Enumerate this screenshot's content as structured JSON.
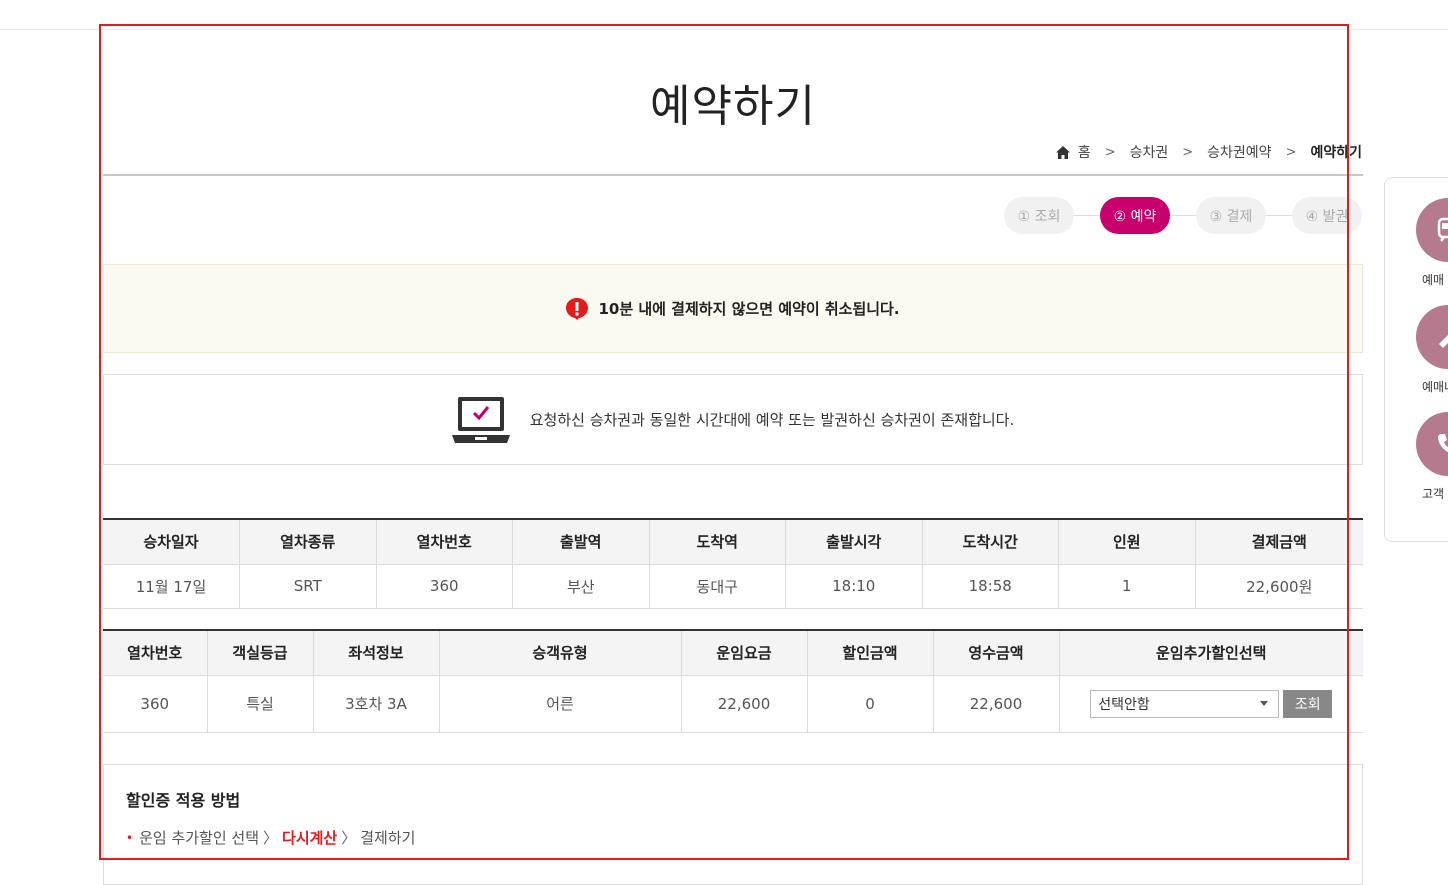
{
  "page": {
    "title": "예약하기"
  },
  "breadcrumb": {
    "home": "홈",
    "item1": "승차권",
    "item2": "승차권예약",
    "current": "예약하기"
  },
  "steps": [
    {
      "label": "① 조회"
    },
    {
      "label": "② 예약"
    },
    {
      "label": "③ 결제"
    },
    {
      "label": "④ 발권"
    }
  ],
  "notice": {
    "text": "10분 내에 결제하지 않으면 예약이 취소됩니다."
  },
  "duplicate": {
    "text": "요청하신 승차권과 동일한 시간대에 예약 또는 발권하신 승차권이 존재합니다."
  },
  "train_table": {
    "headers": [
      "승차일자",
      "열차종류",
      "열차번호",
      "출발역",
      "도착역",
      "출발시각",
      "도착시간",
      "인원",
      "결제금액"
    ],
    "row": [
      "11월 17일",
      "SRT",
      "360",
      "부산",
      "동대구",
      "18:10",
      "18:58",
      "1",
      "22,600원"
    ]
  },
  "fare_table": {
    "headers": [
      "열차번호",
      "객실등급",
      "좌석정보",
      "승객유형",
      "운임요금",
      "할인금액",
      "영수금액",
      "운임추가할인선택"
    ],
    "row": [
      "360",
      "특실",
      "3호차 3A",
      "어른",
      "22,600",
      "0",
      "22,600"
    ],
    "select_value": "선택안함",
    "lookup_button": "조회"
  },
  "discount": {
    "title": "할인증 적용 방법",
    "step1": "운임 추가할인 선택",
    "step2": "다시계산",
    "step3": "결제하기"
  },
  "quick_menu": [
    {
      "label": "예매",
      "icon": "train-icon"
    },
    {
      "label": "예매내역",
      "icon": "ticket-icon"
    },
    {
      "label": "고객",
      "icon": "phone-icon"
    }
  ],
  "colors": {
    "accent": "#c8006e",
    "warning": "#e41b1b",
    "quick_menu": "#b57a8d"
  }
}
